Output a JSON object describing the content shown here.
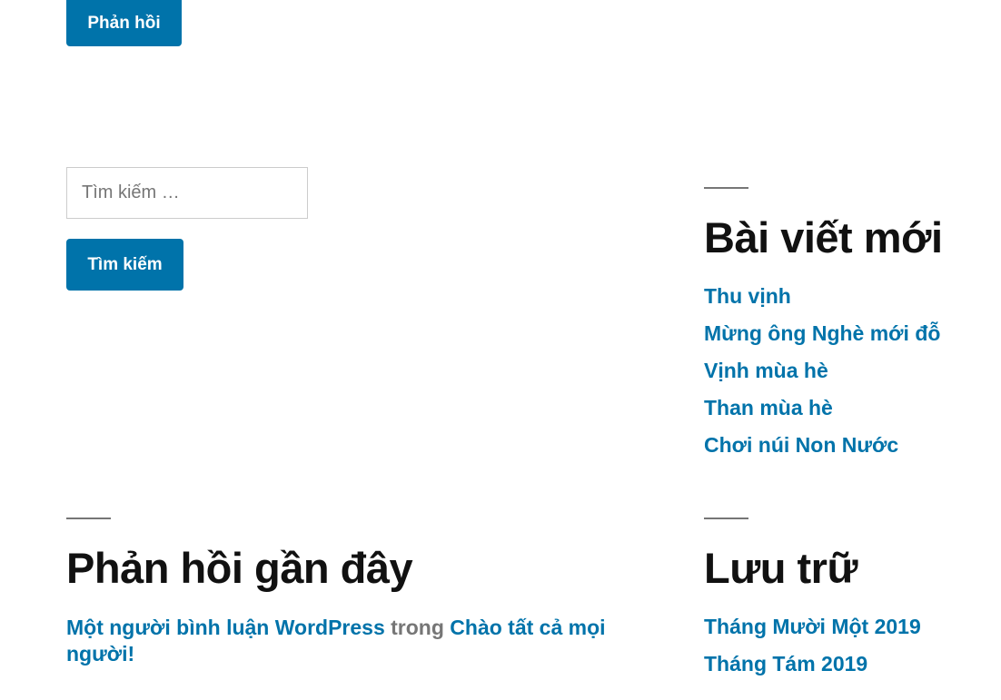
{
  "reply_button": {
    "label": "Phản hồi"
  },
  "search": {
    "placeholder": "Tìm kiếm …",
    "button_label": "Tìm kiếm"
  },
  "recent_posts": {
    "title": "Bài viết mới",
    "items": [
      {
        "label": "Thu vịnh"
      },
      {
        "label": "Mừng ông Nghè mới đỗ"
      },
      {
        "label": "Vịnh mùa hè"
      },
      {
        "label": "Than mùa hè"
      },
      {
        "label": "Chơi núi Non Nước"
      }
    ]
  },
  "recent_comments": {
    "title": "Phản hồi gần đây",
    "items": [
      {
        "author": "Một người bình luận WordPress",
        "connector": "trong",
        "post": "Chào tất cả mọi người!"
      }
    ]
  },
  "archives": {
    "title": "Lưu trữ",
    "items": [
      {
        "label": "Tháng Mười Một 2019"
      },
      {
        "label": "Tháng Tám 2019"
      }
    ]
  },
  "colors": {
    "accent": "#0073aa",
    "heading": "#111111",
    "muted": "#767676",
    "background": "#ffffff"
  }
}
